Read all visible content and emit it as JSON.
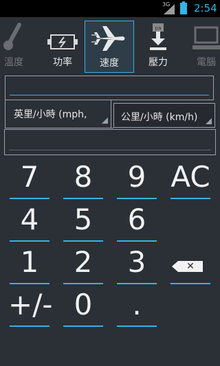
{
  "status": {
    "network": "3G",
    "time": "2:54"
  },
  "tabs": [
    {
      "label": "溫度",
      "icon": "thermometer-icon",
      "state": "dim"
    },
    {
      "label": "功率",
      "icon": "battery-icon",
      "state": "normal"
    },
    {
      "label": "速度",
      "icon": "airplane-icon",
      "state": "active"
    },
    {
      "label": "壓力",
      "icon": "pressure-icon",
      "state": "normal"
    },
    {
      "label": "電腦",
      "icon": "computer-icon",
      "state": "dim"
    }
  ],
  "converter": {
    "input_value": "",
    "from_unit": "英里/小時 (mph,",
    "to_unit": "公里/小時 (km/h)",
    "result_value": ""
  },
  "keypad": {
    "row1": [
      "7",
      "8",
      "9",
      "AC"
    ],
    "row2": [
      "4",
      "5",
      "6"
    ],
    "row3": [
      "1",
      "2",
      "3"
    ],
    "row4": [
      "+/-",
      "0",
      "."
    ],
    "backspace_glyph": "✕"
  },
  "colors": {
    "accent": "#33b5e5",
    "background": "#2b2f36"
  }
}
